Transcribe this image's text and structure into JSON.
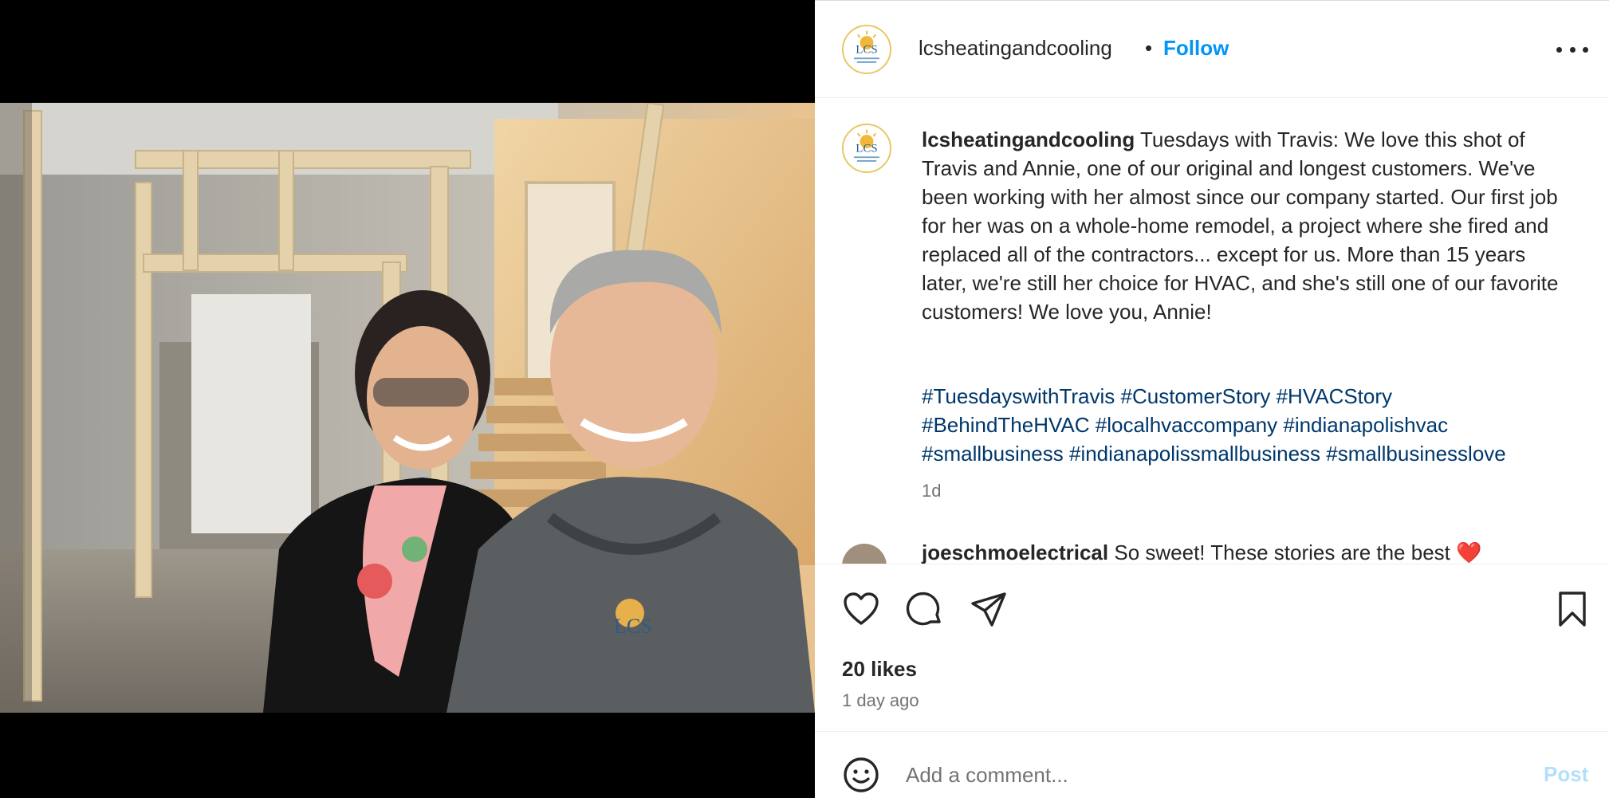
{
  "post": {
    "username": "lcsheatingandcooling",
    "separator": "•",
    "follow_label": "Follow",
    "more_icon": "more-horizontal-icon",
    "logo_text": "LCS",
    "caption_username": "lcsheatingandcooling",
    "caption_text": "Tuesdays with Travis: We love this shot of Travis and Annie, one of our original and longest customers. We've been working with her almost since our company started. Our first job for her was on a whole-home remodel, a project where she fired and replaced all of the contractors... except for us. More than 15 years later, we're still her choice for HVAC, and she's still one of our favorite customers! We love you, Annie!",
    "hashtags": [
      "#TuesdayswithTravis",
      "#CustomerStory",
      "#HVACStory",
      "#BehindTheHVAC",
      "#localhvaccompany",
      "#indianapolishvac",
      "#smallbusiness",
      "#indianapolissmallbusiness",
      "#smallbusinesslove"
    ],
    "caption_age": "1d",
    "likes": "20 likes",
    "posted_ago": "1 day ago"
  },
  "comment": {
    "username": "joeschmoelectrical",
    "text": "So sweet! These stories are the best",
    "emoji": "❤️"
  },
  "composer": {
    "placeholder": "Add a comment...",
    "post_label": "Post"
  },
  "icons": [
    "heart-icon",
    "comment-icon",
    "share-icon",
    "bookmark-icon",
    "emoji-icon"
  ],
  "colors": {
    "accent": "#0095f6",
    "hashtag": "#00376b",
    "muted": "#737373"
  }
}
